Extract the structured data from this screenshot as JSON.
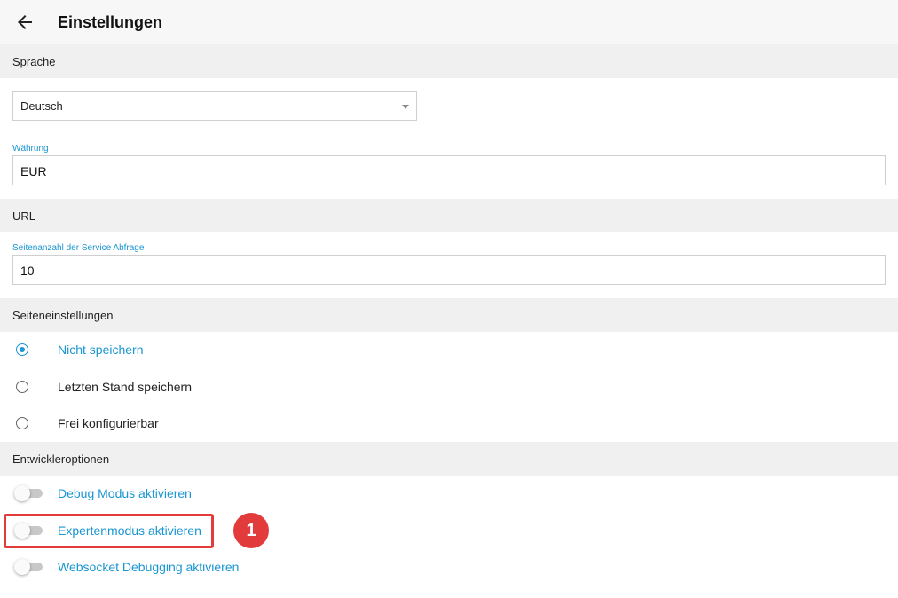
{
  "header": {
    "title": "Einstellungen",
    "back_icon": "arrow-left-icon"
  },
  "sections": {
    "language": "Sprache",
    "url": "URL",
    "page_settings": "Seiteneinstellungen",
    "developer": "Entwickleroptionen"
  },
  "language_select": {
    "value": "Deutsch"
  },
  "currency": {
    "label": "Währung",
    "value": "EUR"
  },
  "service_pages": {
    "label": "Seitenanzahl der Service Abfrage",
    "value": "10"
  },
  "page_options": [
    {
      "label": "Nicht speichern",
      "checked": true
    },
    {
      "label": "Letzten Stand speichern",
      "checked": false
    },
    {
      "label": "Frei konfigurierbar",
      "checked": false
    }
  ],
  "developer_options": [
    {
      "label": "Debug Modus aktivieren",
      "enabled": false
    },
    {
      "label": "Expertenmodus aktivieren",
      "enabled": false
    },
    {
      "label": "Websocket Debugging aktivieren",
      "enabled": false
    }
  ],
  "annotation": {
    "badge": "1",
    "color": "#e23b3b"
  },
  "colors": {
    "accent": "#1a96d2",
    "section_bg": "#f0f0f0"
  }
}
